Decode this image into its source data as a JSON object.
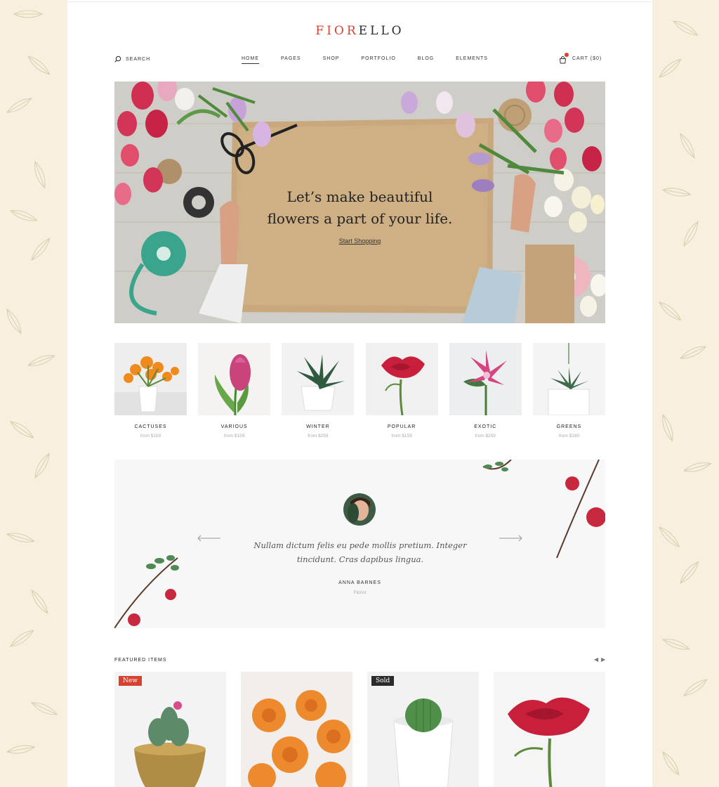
{
  "brand": {
    "logo_red": "FIOR",
    "logo_dark": "ELLO"
  },
  "header": {
    "search_label": "SEARCH",
    "menu": [
      {
        "label": "HOME",
        "active": true
      },
      {
        "label": "PAGES"
      },
      {
        "label": "SHOP"
      },
      {
        "label": "PORTFOLIO"
      },
      {
        "label": "BLOG"
      },
      {
        "label": "ELEMENTS"
      }
    ],
    "cart_label": "CART ($0)"
  },
  "hero": {
    "title_line1": "Let’s make beautiful",
    "title_line2": "flowers a part of your life.",
    "cta": "Start Shopping"
  },
  "categories": [
    {
      "name": "CACTUSES",
      "price": "from $159"
    },
    {
      "name": "VARIOUS",
      "price": "from $159"
    },
    {
      "name": "WINTER",
      "price": "from $259"
    },
    {
      "name": "POPULAR",
      "price": "from $159"
    },
    {
      "name": "EXOTIC",
      "price": "from $259"
    },
    {
      "name": "GREENS",
      "price": "from $180"
    }
  ],
  "testimonial": {
    "quote_line1": "Nullam dictum felis eu pede mollis pretium. Integer",
    "quote_line2": "tincidunt. Cras dapibus lingua.",
    "author": "ANNA BARNES",
    "role": "Florist"
  },
  "featured": {
    "title": "FEATURED ITEMS",
    "badges": {
      "new": "New",
      "sold": "Sold"
    }
  },
  "colors": {
    "accent": "#d8412f",
    "background": "#f8efdf",
    "dark": "#2b2b2b"
  }
}
